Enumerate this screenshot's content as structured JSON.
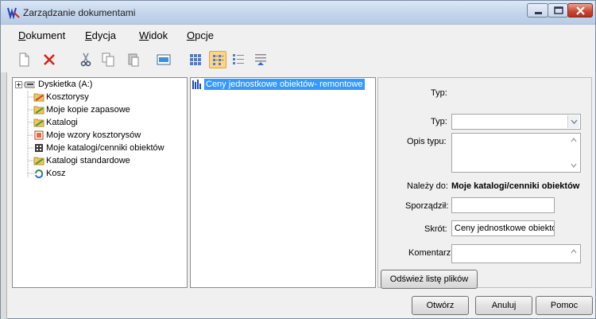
{
  "window": {
    "title": "Zarządzanie dokumentami",
    "controls": [
      "minimize",
      "maximize",
      "close"
    ]
  },
  "menu": [
    {
      "label": "Dokument"
    },
    {
      "label": "Edycja"
    },
    {
      "label": "Widok"
    },
    {
      "label": "Opcje"
    }
  ],
  "toolbar": {
    "icons": [
      "new-icon",
      "delete-icon",
      "cut-icon",
      "copy-icon",
      "paste-icon",
      "properties-icon",
      "large-icons-view-icon",
      "small-icons-view-icon",
      "list-view-icon",
      "details-view-icon"
    ],
    "active": "small-icons-view-icon"
  },
  "tree": {
    "root": {
      "label": "Dyskietka (A:)",
      "icon": "floppy-drive-icon",
      "expander": "+"
    },
    "items": [
      {
        "label": "Kosztorysy",
        "icon": "folder-icon"
      },
      {
        "label": "Moje kopie zapasowe",
        "icon": "folder-icon"
      },
      {
        "label": "Katalogi",
        "icon": "folder-icon"
      },
      {
        "label": "Moje wzory kosztorysów",
        "icon": "template-icon"
      },
      {
        "label": "Moje katalogi/cenniki obiektów",
        "icon": "catalog-icon"
      },
      {
        "label": "Katalogi standardowe",
        "icon": "folder-icon"
      },
      {
        "label": "Kosz",
        "icon": "recycle-bin-icon"
      }
    ]
  },
  "file_list": {
    "items": [
      {
        "label": "Ceny jednostkowe obiektów- remontowe",
        "selected": true,
        "icon": "catalog-file-icon"
      }
    ]
  },
  "properties": {
    "typ_header": "Typ:",
    "typ_label": "Typ:",
    "typ_value": "",
    "opis_label": "Opis typu:",
    "opis_value": "",
    "nalezy_label": "Należy do:",
    "nalezy_value": "Moje katalogi/cenniki obiektów",
    "sporzadzil_label": "Sporządził:",
    "sporzadzil_value": "",
    "skrot_label": "Skrót:",
    "skrot_value": "Ceny jednostkowe obiektów",
    "komentarz_label": "Komentarz:",
    "komentarz_value": "",
    "refresh_button": "Odśwież listę plików"
  },
  "buttons": {
    "open": "Otwórz",
    "cancel": "Anuluj",
    "help": "Pomoc"
  }
}
